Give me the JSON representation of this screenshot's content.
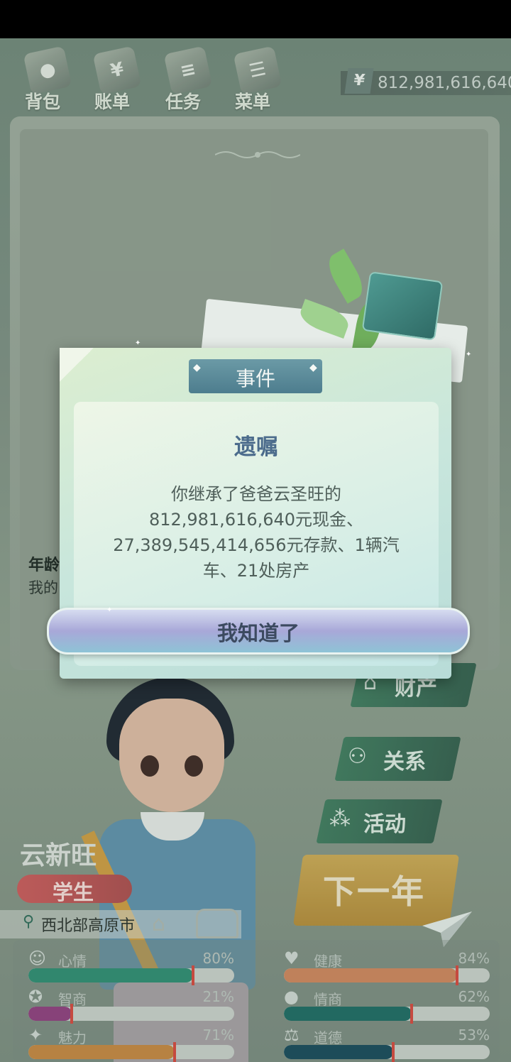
{
  "topbar": {
    "items": [
      {
        "label": "背包",
        "icon": "backpack-icon",
        "glyph": "●"
      },
      {
        "label": "账单",
        "icon": "bill-icon",
        "glyph": "¥"
      },
      {
        "label": "任务",
        "icon": "task-icon",
        "glyph": "≡"
      },
      {
        "label": "菜单",
        "icon": "menu-icon",
        "glyph": "☰"
      }
    ],
    "currency_symbol": "¥",
    "money": "812,981,616,640"
  },
  "profile": {
    "age_prefix": "年龄",
    "desc_prefix": "我的",
    "name": "云新旺",
    "role": "学生",
    "location": "西北部高原市"
  },
  "side_menu": [
    {
      "label": "财产",
      "icon": "house-icon",
      "glyph": "⌂"
    },
    {
      "label": "关系",
      "icon": "people-icon",
      "glyph": "⚇"
    },
    {
      "label": "活动",
      "icon": "activity-icon",
      "glyph": "⁂"
    }
  ],
  "next_year": "下一年",
  "stats": [
    {
      "label": "心情",
      "value": "80%",
      "fraction": 0.8,
      "color": "#2f8a70",
      "icon": "smile-icon",
      "glyph": "☺"
    },
    {
      "label": "健康",
      "value": "84%",
      "fraction": 0.84,
      "color": "#c9845c",
      "icon": "heart-icon",
      "glyph": "♥"
    },
    {
      "label": "智商",
      "value": "21%",
      "fraction": 0.21,
      "color": "#8c3f7c",
      "icon": "brain-icon",
      "glyph": "✪"
    },
    {
      "label": "情商",
      "value": "62%",
      "fraction": 0.62,
      "color": "#1f6a62",
      "icon": "apple-icon",
      "glyph": "●"
    },
    {
      "label": "魅力",
      "value": "71%",
      "fraction": 0.71,
      "color": "#c08540",
      "icon": "star-icon",
      "glyph": "✦"
    },
    {
      "label": "道德",
      "value": "53%",
      "fraction": 0.53,
      "color": "#1a4a5a",
      "icon": "scale-icon",
      "glyph": "⚖"
    }
  ],
  "dialog": {
    "header": "事件",
    "title": "遗嘱",
    "body_lines": [
      "你继承了爸爸云圣旺的",
      "812,981,616,640元现金、",
      "27,389,545,414,656元存款、1辆汽",
      "车、21处房产"
    ],
    "button": "我知道了"
  },
  "colors": {
    "accent_green": "#3f7a5e",
    "dialog_title": "#4c6c8c",
    "role_badge": "#c65a5a",
    "next_year_gold": "#c7a654"
  }
}
